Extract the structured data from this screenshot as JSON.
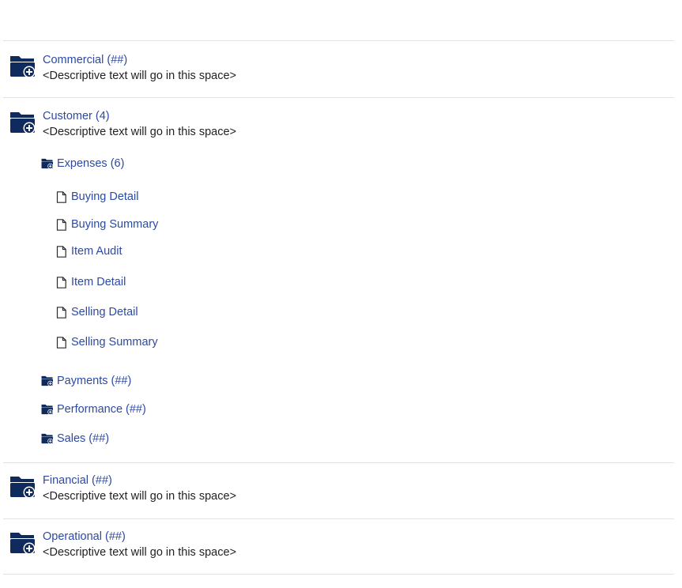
{
  "colors": {
    "link": "#2d4aa2",
    "folder_icon": "#0f2a5c",
    "text": "#222222",
    "divider": "#e2e2e2"
  },
  "categories": [
    {
      "title": "Commercial (##)",
      "description": "<Descriptive text will go in this space>",
      "icon": "folder-plus-icon"
    },
    {
      "title": "Customer (4)",
      "description": "<Descriptive text will go in this space>",
      "icon": "folder-plus-icon",
      "expanded": true
    },
    {
      "title": "Financial (##)",
      "description": "<Descriptive text will go in this space>",
      "icon": "folder-plus-icon"
    },
    {
      "title": "Operational (##)",
      "description": "<Descriptive text will go in this space>",
      "icon": "folder-plus-icon"
    }
  ],
  "customer_subfolders": [
    {
      "label": "Expenses (6)",
      "icon": "folder-plus-icon",
      "expanded": true
    },
    {
      "label": "Payments (##)",
      "icon": "folder-plus-icon"
    },
    {
      "label": "Performance (##)",
      "icon": "folder-plus-icon"
    },
    {
      "label": "Sales (##)",
      "icon": "folder-plus-icon"
    }
  ],
  "expenses_reports": [
    {
      "label": "Buying Detail",
      "icon": "document-icon"
    },
    {
      "label": "Buying Summary",
      "icon": "document-icon"
    },
    {
      "label": "Item Audit",
      "icon": "document-icon"
    },
    {
      "label": "Item Detail",
      "icon": "document-icon"
    },
    {
      "label": "Selling Detail",
      "icon": "document-icon"
    },
    {
      "label": "Selling Summary",
      "icon": "document-icon"
    }
  ]
}
